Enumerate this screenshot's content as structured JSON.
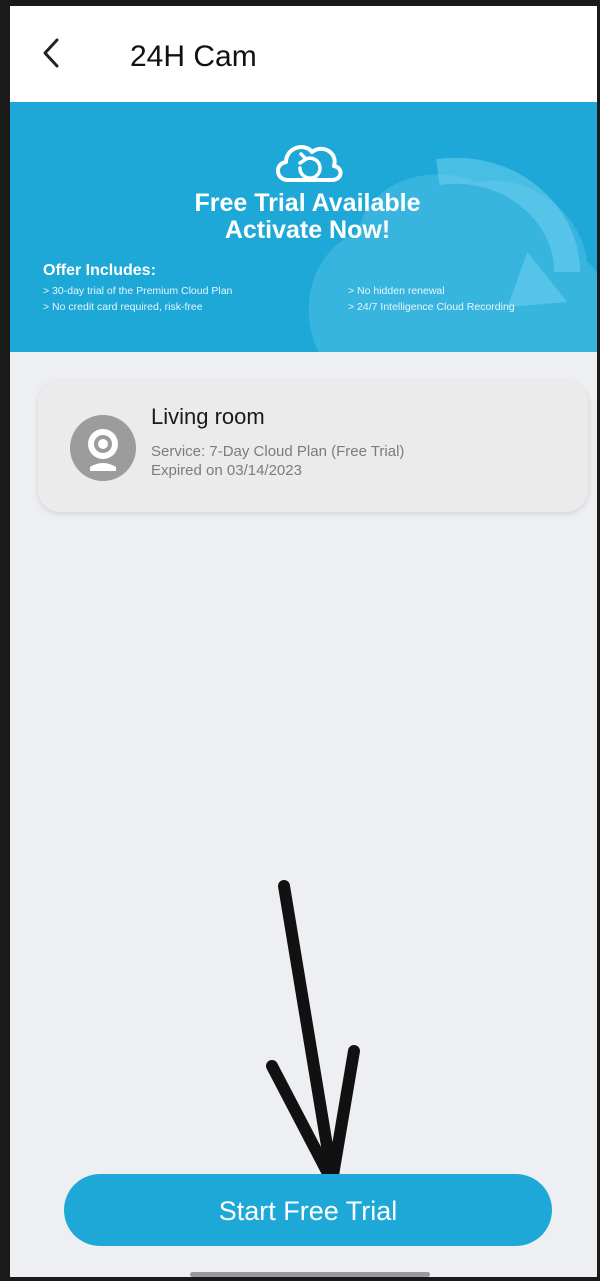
{
  "header": {
    "title": "24H Cam",
    "back_icon": "chevron-left-icon"
  },
  "banner": {
    "icon": "cloud-refresh-icon",
    "title_line1": "Free Trial Available",
    "title_line2": "Activate Now!",
    "offer_heading": "Offer Includes:",
    "offers": [
      "> 30-day trial of the Premium Cloud Plan",
      "> No hidden renewal",
      "> No credit card required, risk-free",
      "> 24/7 Intelligence Cloud Recording"
    ],
    "bg_color": "#1ea8d8"
  },
  "device": {
    "name": "Living room",
    "service": "Service: 7-Day Cloud Plan (Free Trial)",
    "expiry": "Expired on 03/14/2023",
    "avatar_icon": "camera-icon"
  },
  "cta": {
    "label": "Start Free Trial",
    "color": "#1ea8d8"
  }
}
